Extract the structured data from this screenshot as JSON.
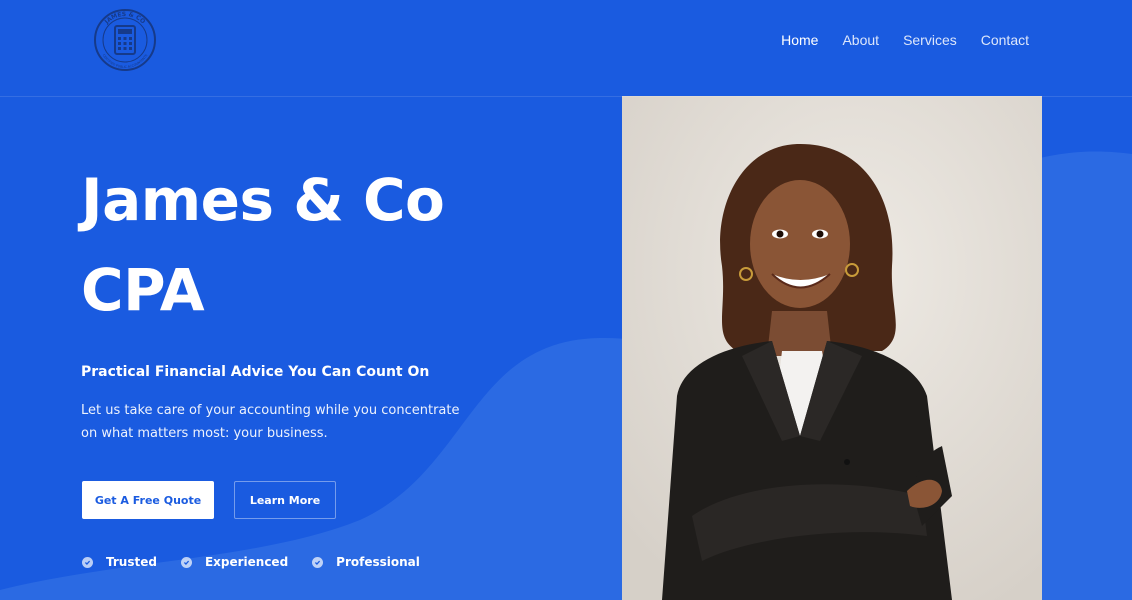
{
  "header": {
    "logo": {
      "text_top": "JAMES & CO",
      "text_bottom": "CERTIFIED PUBLIC ACCOUNTANTS",
      "icon": "calculator-icon"
    },
    "nav": [
      {
        "label": "Home",
        "active": true
      },
      {
        "label": "About",
        "active": false
      },
      {
        "label": "Services",
        "active": false
      },
      {
        "label": "Contact",
        "active": false
      }
    ]
  },
  "hero": {
    "title_line1": "James & Co",
    "title_line2": "CPA",
    "subtitle": "Practical Financial Advice You Can Count On",
    "description": "Let us take care of your accounting while you concentrate on what matters most: your business.",
    "primary_button": "Get A Free Quote",
    "secondary_button": "Learn More",
    "features": [
      "Trusted",
      "Experienced",
      "Professional"
    ]
  },
  "colors": {
    "background": "#1a5be0",
    "primary_text": "#ffffff",
    "button_text": "#1a5be0"
  }
}
